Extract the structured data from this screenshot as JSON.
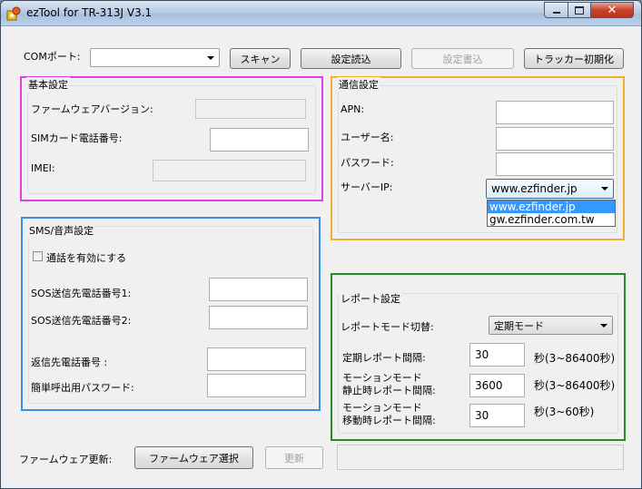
{
  "window": {
    "title": "ezTool for TR-313J V3.1"
  },
  "toolbar": {
    "com_label": "COMポート:",
    "com_value": "",
    "scan": "スキャン",
    "read_settings": "設定読込",
    "write_settings": "設定書込",
    "init_tracker": "トラッカー初期化"
  },
  "basic": {
    "title": "基本設定",
    "firmware_label": "ファームウェアバージョン:",
    "firmware_value": "",
    "sim_label": "SIMカード電話番号:",
    "sim_value": "",
    "imei_label": "IMEI:",
    "imei_value": ""
  },
  "sms": {
    "title": "SMS/音声設定",
    "enable_call": "通話を有効にする",
    "enable_call_checked": false,
    "sos1_label": "SOS送信先電話番号1:",
    "sos1_value": "",
    "sos2_label": "SOS送信先電話番号2:",
    "sos2_value": "",
    "reply_label": "返信先電話番号 :",
    "reply_value": "",
    "password_label": "簡単呼出用パスワード:",
    "password_value": ""
  },
  "comm": {
    "title": "通信設定",
    "apn_label": "APN:",
    "apn_value": "",
    "user_label": "ユーザー名:",
    "user_value": "",
    "password_label": "パスワード:",
    "password_value": "",
    "server_label": "サーバーIP:",
    "server_value": "www.ezfinder.jp",
    "server_options": [
      "www.ezfinder.jp",
      "gw.ezfinder.com.tw"
    ]
  },
  "report": {
    "title": "レポート設定",
    "mode_label": "レポートモード切替:",
    "mode_value": "定期モード",
    "interval_label": "定期レポート間隔:",
    "interval_value": "30",
    "interval_unit": "秒(3~86400秒)",
    "static_label_1": "モーションモード",
    "static_label_2": "静止時レポート間隔:",
    "static_value": "3600",
    "static_unit": "秒(3~86400秒)",
    "moving_label_1": "モーションモード",
    "moving_label_2": "移動時レポート間隔:",
    "moving_value": "30",
    "moving_unit": "秒(3~60秒)"
  },
  "firmware_update": {
    "label": "ファームウェア更新:",
    "select": "ファームウェア選択",
    "update": "更新",
    "status": ""
  },
  "colors": {
    "basic_border": "#e040e0",
    "sms_border": "#3a8ee6",
    "comm_border": "#f0b030",
    "report_border": "#2a8a2a"
  }
}
